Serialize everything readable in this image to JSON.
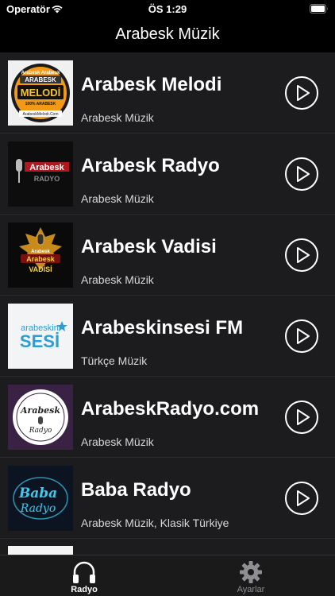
{
  "status_bar": {
    "carrier": "Operatör",
    "time": "ÖS 1:29"
  },
  "nav": {
    "title": "Arabesk Müzik"
  },
  "stations": [
    {
      "title": "Arabesk Melodi",
      "subtitle": "Arabesk Müzik",
      "logo": "arabesk-melodi-logo",
      "logo_text": {
        "top": "Arabesk Arabesk",
        "banner": "ARABESK",
        "main": "MELODİ",
        "tag": "100% ARABESK",
        "url": "ArabeskMelodi.Com"
      }
    },
    {
      "title": "Arabesk Radyo",
      "subtitle": "Arabesk Müzik",
      "logo": "arabesk-radyo-logo",
      "logo_text": {
        "main": "Arabesk",
        "sub": "RADYO"
      }
    },
    {
      "title": "Arabesk Vadisi",
      "subtitle": "Arabesk Müzik",
      "logo": "arabesk-vadisi-logo",
      "logo_text": {
        "top": "Arabesk",
        "main": "Arabesk",
        "sub": "VADİSİ"
      }
    },
    {
      "title": "Arabeskinsesi FM",
      "subtitle": "Türkçe Müzik",
      "logo": "arabeskin-sesi-logo",
      "logo_text": {
        "top": "arabeskin",
        "main": "SESİ"
      }
    },
    {
      "title": "ArabeskRadyo.com",
      "subtitle": "Arabesk Müzik",
      "logo": "arabeskradyo-com-logo",
      "logo_text": {
        "main": "Arabesk",
        "sub": "Radyo"
      }
    },
    {
      "title": "Baba Radyo",
      "subtitle": "Arabesk Müzik, Klasik Türkiye",
      "logo": "baba-radyo-logo",
      "logo_text": {
        "main": "Baba",
        "sub": "Radyo"
      }
    }
  ],
  "tabs": [
    {
      "label": "Radyo",
      "icon": "headphones-icon",
      "active": true
    },
    {
      "label": "Ayarlar",
      "icon": "gear-icon",
      "active": false
    }
  ],
  "colors": {
    "background": "#000000",
    "list_background": "#1c1c1e",
    "tab_active": "#ffffff",
    "tab_inactive": "#8e8e93",
    "baba_neon": "#3ec9f0"
  }
}
